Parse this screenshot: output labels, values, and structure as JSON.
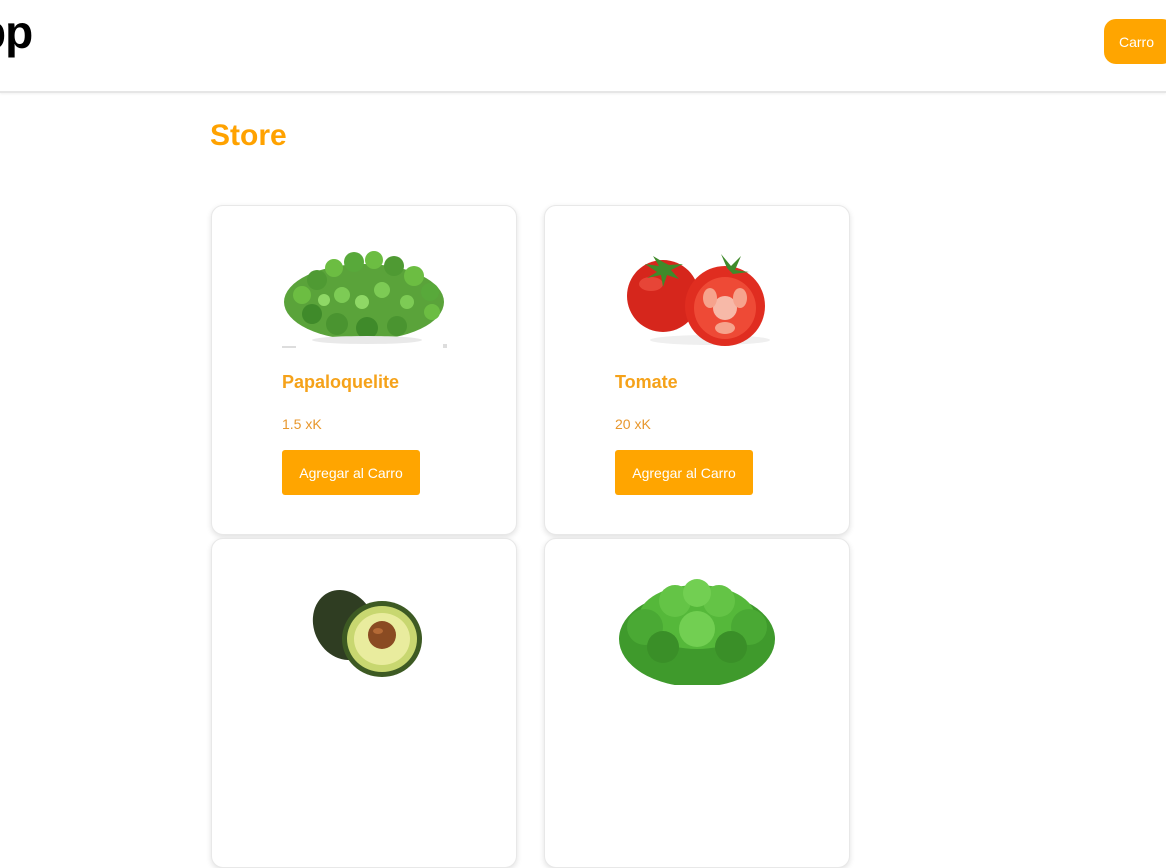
{
  "header": {
    "logo_text": "pp",
    "cart_label": "Carro"
  },
  "page_title": "Store",
  "products": [
    {
      "name": "Papaloquelite",
      "price": "1.5 xK",
      "button_label": "Agregar al Carro",
      "image_icon": "cilantro-greens-image"
    },
    {
      "name": "Tomate",
      "price": "20 xK",
      "button_label": "Agregar al Carro",
      "image_icon": "tomato-image"
    },
    {
      "name": "",
      "price": "",
      "button_label": "",
      "image_icon": "avocado-image"
    },
    {
      "name": "",
      "price": "",
      "button_label": "",
      "image_icon": "lettuce-image"
    }
  ],
  "colors": {
    "accent": "#ffa500",
    "title": "#ffa200"
  }
}
